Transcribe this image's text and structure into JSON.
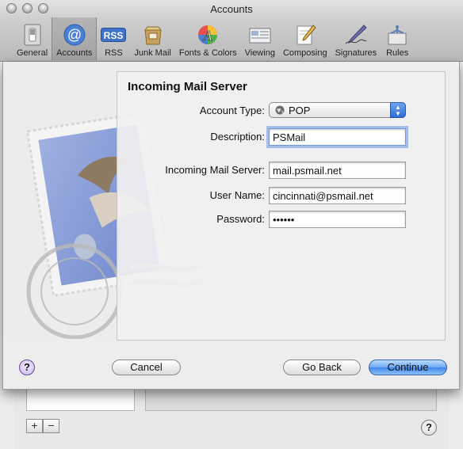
{
  "window": {
    "title": "Accounts"
  },
  "toolbar": {
    "items": [
      {
        "label": "General",
        "icon": "general-switch-icon"
      },
      {
        "label": "Accounts",
        "icon": "at-sign-icon",
        "active": true
      },
      {
        "label": "RSS",
        "icon": "rss-icon"
      },
      {
        "label": "Junk Mail",
        "icon": "junk-mail-icon"
      },
      {
        "label": "Fonts & Colors",
        "icon": "fonts-colors-icon"
      },
      {
        "label": "Viewing",
        "icon": "viewing-icon"
      },
      {
        "label": "Composing",
        "icon": "composing-pencil-icon"
      },
      {
        "label": "Signatures",
        "icon": "signatures-pen-icon"
      },
      {
        "label": "Rules",
        "icon": "rules-icon"
      }
    ]
  },
  "sheet": {
    "heading": "Incoming Mail Server",
    "account_type": {
      "label": "Account Type:",
      "value": "POP"
    },
    "description": {
      "label": "Description:",
      "value": "PSMail"
    },
    "server": {
      "label": "Incoming Mail Server:",
      "value": "mail.psmail.net"
    },
    "username": {
      "label": "User Name:",
      "value": "cincinnati@psmail.net"
    },
    "password": {
      "label": "Password:",
      "value": "••••••"
    },
    "buttons": {
      "cancel": "Cancel",
      "back": "Go Back",
      "continue": "Continue"
    },
    "help": "?"
  },
  "background": {
    "add": "+",
    "remove": "−",
    "help": "?"
  },
  "colors": {
    "accent": "#3f86ea",
    "focus": "#6f9ad7"
  }
}
